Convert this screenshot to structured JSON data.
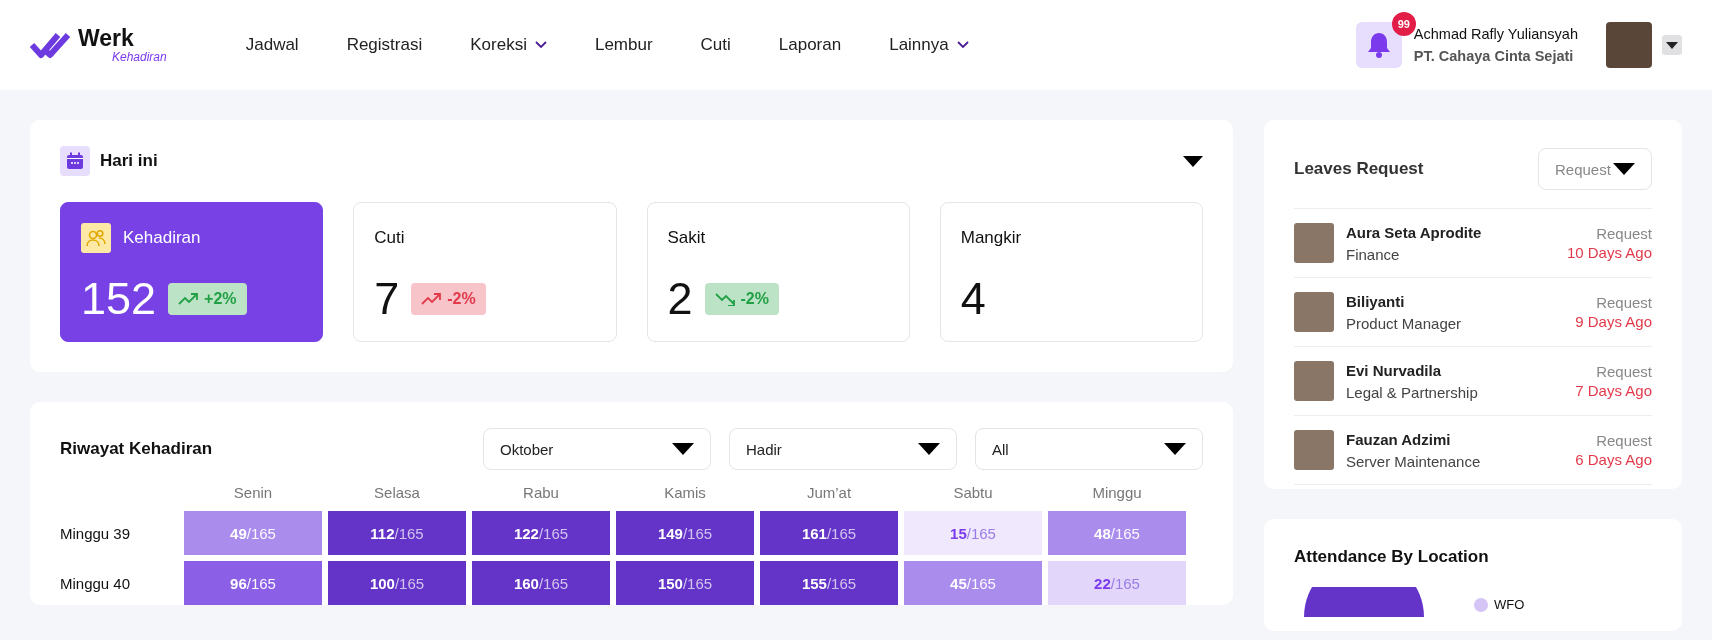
{
  "header": {
    "logo": {
      "name": "Werk",
      "tagline": "Kehadiran"
    },
    "nav": [
      {
        "label": "Jadwal",
        "has_menu": false
      },
      {
        "label": "Registrasi",
        "has_menu": false
      },
      {
        "label": "Koreksi",
        "has_menu": true
      },
      {
        "label": "Lembur",
        "has_menu": false
      },
      {
        "label": "Cuti",
        "has_menu": false
      },
      {
        "label": "Laporan",
        "has_menu": false
      },
      {
        "label": "Lainnya",
        "has_menu": true
      }
    ],
    "notifications": {
      "count": "99"
    },
    "user": {
      "name": "Achmad Rafly Yuliansyah",
      "company": "PT. Cahaya Cinta Sejati"
    }
  },
  "today": {
    "title": "Hari ini",
    "stats": [
      {
        "label": "Kehadiran",
        "value": "152",
        "selected": true,
        "trend": {
          "kind": "rise",
          "color": "#22a045",
          "text": "+2%"
        }
      },
      {
        "label": "Cuti",
        "value": "7",
        "selected": false,
        "trend": {
          "kind": "rise",
          "color": "#e23a4b",
          "text": "-2%"
        }
      },
      {
        "label": "Sakit",
        "value": "2",
        "selected": false,
        "trend": {
          "kind": "fall",
          "color": "#22a045",
          "text": "-2%"
        }
      },
      {
        "label": "Mangkir",
        "value": "4",
        "selected": false
      }
    ]
  },
  "history": {
    "title": "Riwayat Kehadiran",
    "filters": [
      "Oktober",
      "Hadir",
      "All"
    ],
    "days": [
      "Senin",
      "Selasa",
      "Rabu",
      "Kamis",
      "Jum’at",
      "Sabtu",
      "Minggu"
    ],
    "weeks": [
      {
        "label": "Minggu 39",
        "cells": [
          {
            "text": "**49**/165",
            "color": "#a98cec"
          },
          {
            "text": "**112**/165",
            "color": "#6434c9"
          },
          {
            "text": "**122**/165",
            "color": "#6434c9"
          },
          {
            "text": "**149**/165",
            "color": "#6434c9"
          },
          {
            "text": "**161**/165",
            "color": "#6434c9"
          },
          {
            "text": "**15**/165",
            "color": "#f0e8fd"
          },
          {
            "text": "**48**/165",
            "color": "#a98cec"
          }
        ]
      },
      {
        "label": "Minggu 40",
        "cells": [
          {
            "text": "**96**/165",
            "color": "#8b5fe6"
          },
          {
            "text": "**100**/165",
            "color": "#6434c9"
          },
          {
            "text": "**160**/165",
            "color": "#6434c9"
          },
          {
            "text": "**150**/165",
            "color": "#6434c9"
          },
          {
            "text": "**155**/165",
            "color": "#6434c9"
          },
          {
            "text": "**45**/165",
            "color": "#a98cec"
          },
          {
            "text": "**22**/165",
            "color": "#e2d7fb"
          }
        ]
      }
    ]
  },
  "leaves": {
    "title": "Leaves Request",
    "filter": "Request",
    "items": [
      {
        "name": "Aura Seta Aprodite",
        "department": "Finance",
        "status": "Request",
        "when": "10 Days Ago"
      },
      {
        "name": "Biliyanti",
        "department": "Product Manager",
        "status": "Request",
        "when": "9 Days Ago"
      },
      {
        "name": "Evi Nurvadila",
        "department": "Legal & Partnership",
        "status": "Request",
        "when": "7 Days Ago"
      },
      {
        "name": "Fauzan Adzimi",
        "department": "Server Maintenance",
        "status": "Request",
        "when": "6 Days Ago"
      }
    ]
  },
  "location": {
    "title": "Attendance By Location",
    "legend": [
      {
        "label": "WFO",
        "color": "#d4c5f6"
      }
    ]
  }
}
